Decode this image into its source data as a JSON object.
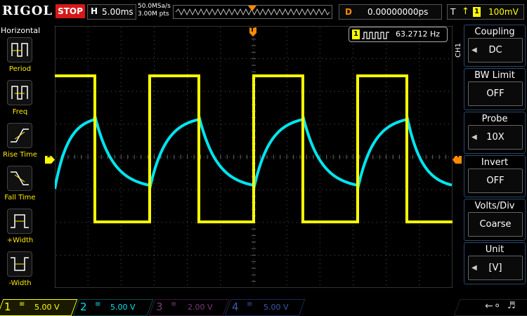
{
  "topbar": {
    "brand": "RIGOL",
    "run_state": "STOP",
    "h_label": "H",
    "timebase": "5.00ms",
    "sample_rate": "50.0MSa/s",
    "memory_depth": "3.00M pts",
    "delay_label": "D",
    "delay_value": "0.00000000ps",
    "trig_label": "T",
    "trig_source": "1",
    "trig_level": "100mV"
  },
  "left_menu": {
    "title": "Horizontal",
    "items": [
      {
        "label": "Period",
        "icon": "period-icon"
      },
      {
        "label": "Freq",
        "icon": "freq-icon"
      },
      {
        "label": "Rise Time",
        "icon": "rise-time-icon"
      },
      {
        "label": "Fall Time",
        "icon": "fall-time-icon"
      },
      {
        "label": "+Width",
        "icon": "pos-width-icon"
      },
      {
        "label": "-Width",
        "icon": "neg-width-icon"
      }
    ]
  },
  "measurement": {
    "channel": "1",
    "value": "63.2712 Hz"
  },
  "right_menu": {
    "channel_label": "CH1",
    "coupling": {
      "header": "Coupling",
      "value": "DC"
    },
    "bw_limit": {
      "header": "BW Limit",
      "value": "OFF"
    },
    "probe": {
      "header": "Probe",
      "value": "10X"
    },
    "invert": {
      "header": "Invert",
      "value": "OFF"
    },
    "volts_div": {
      "header": "Volts/Div",
      "value": "Coarse"
    },
    "unit": {
      "header": "Unit",
      "value": "[V]"
    }
  },
  "channels": [
    {
      "num": "1",
      "scale": "5.00 V",
      "color": "#ffff00"
    },
    {
      "num": "2",
      "scale": "5.00 V",
      "color": "#00e5ee"
    },
    {
      "num": "3",
      "scale": "2.00 V",
      "color": "#cc44cc"
    },
    {
      "num": "4",
      "scale": "5.00 V",
      "color": "#1a5cff"
    }
  ],
  "markers": {
    "ch1": "1",
    "trigger": "T"
  },
  "colors": {
    "ch1": "#ffff00",
    "ch2": "#00e5ee",
    "trigger": "#ff8a00",
    "stop": "#d61818"
  }
}
